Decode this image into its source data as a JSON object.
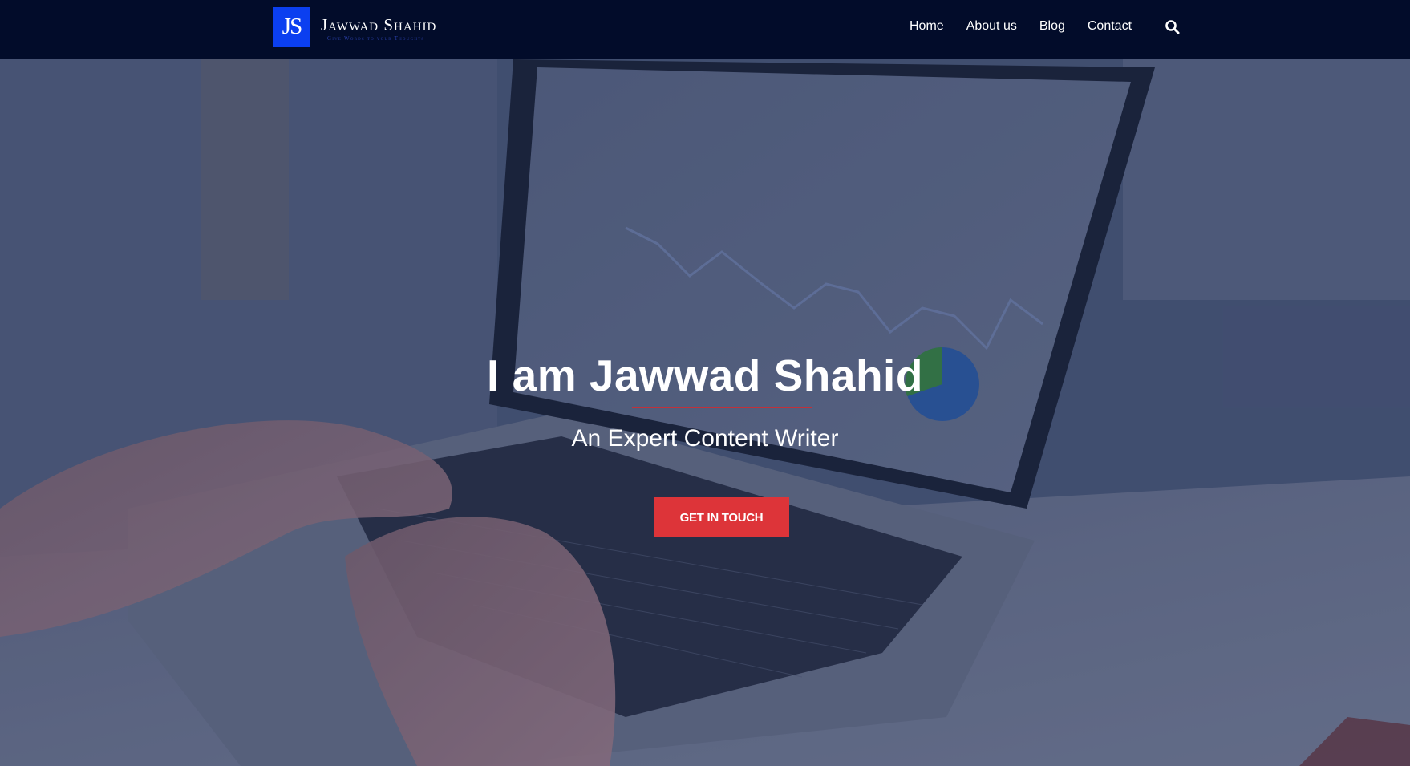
{
  "brand": {
    "badge": "JS",
    "name": "Jawwad Shahid",
    "tagline": "Give Words to your Thoughts",
    "badge_color": "#0b3ff0"
  },
  "nav": {
    "items": [
      {
        "label": "Home"
      },
      {
        "label": "About us"
      },
      {
        "label": "Blog"
      },
      {
        "label": "Contact"
      }
    ],
    "search_icon": "search-icon"
  },
  "hero": {
    "title": "I am Jawwad Shahid",
    "subtitle": "An Expert Content Writer",
    "cta_label": "GET IN TOUCH",
    "cta_color": "#dd3439",
    "divider_color": "#c0313a"
  },
  "colors": {
    "header_bg": "#020c2a",
    "overlay": "#1e2d5a"
  }
}
